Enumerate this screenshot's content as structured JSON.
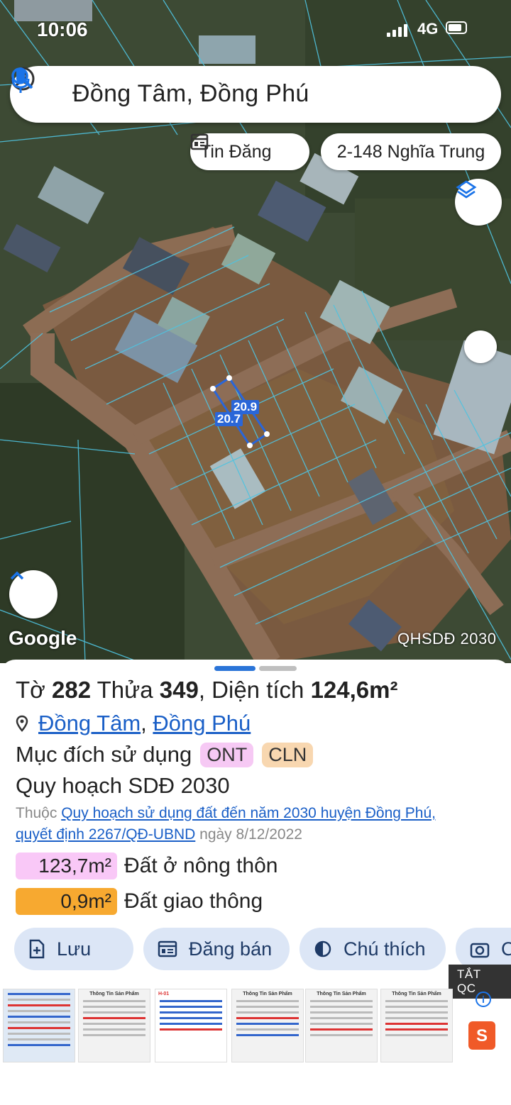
{
  "status_bar": {
    "time": "10:06",
    "network": "4G"
  },
  "search": {
    "text": "Đồng Tâm, Đồng Phú"
  },
  "chips": {
    "news": "Tin Đăng",
    "address": "2-148 Nghĩa Trung"
  },
  "map": {
    "attribution": "Google",
    "overlay_label": "QHSDĐ 2030",
    "dim_a": "20.9",
    "dim_b": "20.7"
  },
  "sheet": {
    "title_to": "Tờ",
    "title_to_val": "282",
    "title_thua": "Thửa",
    "title_thua_val": "349",
    "title_dt": ", Diện tích",
    "title_dt_val": "124,6m²",
    "commune": "Đồng Tâm",
    "district": "Đồng Phú",
    "purpose_label": "Mục đích sử dụng",
    "badge1": "ONT",
    "badge2": "CLN",
    "plan_label": "Quy hoạch SDĐ 2030",
    "note_prefix": "Thuộc",
    "note_link1": "Quy hoạch sử dụng đất đến năm 2030 huyện Đồng Phú,",
    "note_link2": "quyết định 2267/QĐ-UBND",
    "note_suffix": "ngày 8/12/2022",
    "area1_value": "123,7m²",
    "area1_label": "Đất ở nông thôn",
    "area2_value": "0,9m²",
    "area2_label": "Đất giao thông",
    "colors": {
      "ont": "#f9c8f7",
      "transport": "#f7a930",
      "link": "#1a5fc7"
    }
  },
  "actions": {
    "save": "Lưu",
    "sell": "Đăng bán",
    "legend": "Chú thích",
    "camera": "C"
  },
  "ad": {
    "close_label": "TẮT QC",
    "thumb_title": "Thông Tin Sản Phẩm",
    "thumb_code": "H-01",
    "shop_icon": "S"
  }
}
